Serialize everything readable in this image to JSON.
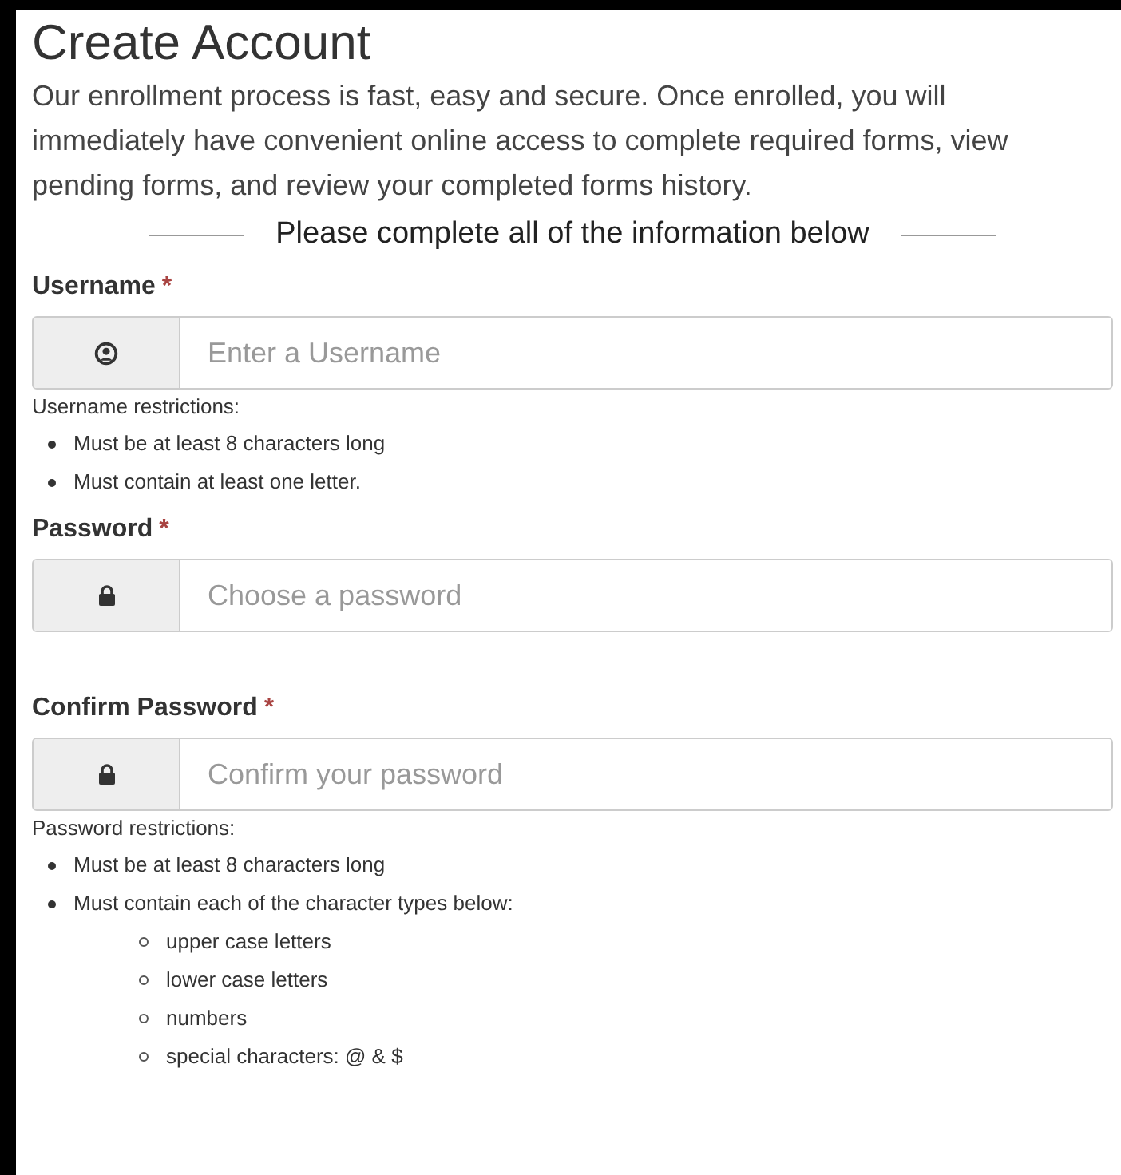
{
  "title": "Create Account",
  "intro": "Our enrollment process is fast, easy and secure. Once enrolled, you will immediately have convenient online access to complete required forms, view pending forms, and review your completed forms history.",
  "section_heading": "Please complete all of the information below",
  "fields": [
    {
      "label": "Username",
      "required_mark": "*",
      "kind": "username",
      "placeholder": "Enter a Username",
      "restrictions": {
        "title": "Username restrictions:",
        "items": [
          {
            "text": "Must be at least 8 characters long"
          },
          {
            "text": "Must contain at least one letter."
          }
        ]
      }
    },
    {
      "label": "Password",
      "required_mark": "*",
      "kind": "password",
      "placeholder": "Choose a password"
    },
    {
      "label": "Confirm Password",
      "required_mark": "*",
      "kind": "password",
      "placeholder": "Confirm your password",
      "restrictions": {
        "title": "Password restrictions:",
        "items": [
          {
            "text": "Must be at least 8 characters long"
          },
          {
            "text": "Must contain each of the character types below:",
            "children": [
              {
                "text": "upper case letters"
              },
              {
                "text": "lower case letters"
              },
              {
                "text": "numbers"
              },
              {
                "text": "special characters: @ & $"
              }
            ]
          }
        ]
      }
    }
  ]
}
